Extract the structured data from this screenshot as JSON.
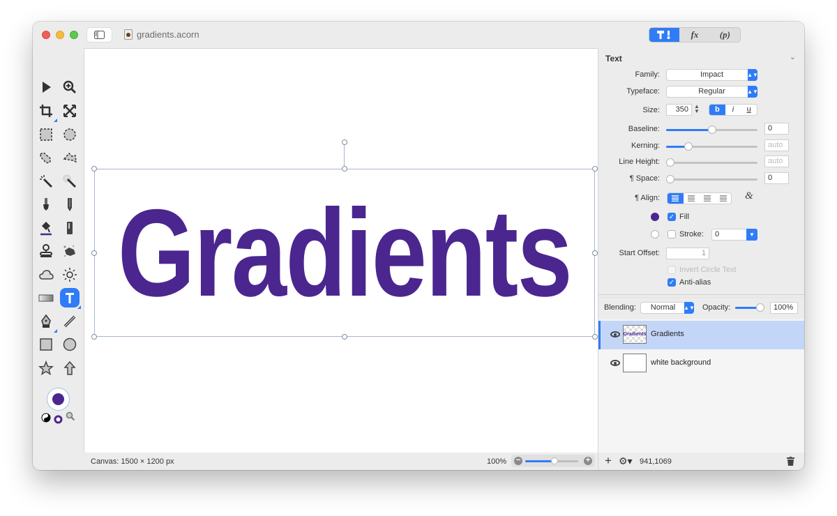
{
  "window": {
    "title": "gradients.acorn",
    "inspector_tabs": [
      {
        "label": "tools-icon",
        "active": true
      },
      {
        "label": "fx",
        "active": false
      },
      {
        "label": "(p)",
        "active": false
      }
    ]
  },
  "toolbox": {
    "tools": [
      {
        "name": "select-arrow-icon"
      },
      {
        "name": "zoom-icon"
      },
      {
        "name": "crop-icon"
      },
      {
        "name": "transform-icon"
      },
      {
        "name": "rect-marquee-icon"
      },
      {
        "name": "ellipse-marquee-icon"
      },
      {
        "name": "lasso-icon"
      },
      {
        "name": "polygon-lasso-icon"
      },
      {
        "name": "magic-wand-icon"
      },
      {
        "name": "instant-alpha-icon"
      },
      {
        "name": "brush-icon"
      },
      {
        "name": "pencil-icon"
      },
      {
        "name": "paint-bucket-icon"
      },
      {
        "name": "eraser-icon"
      },
      {
        "name": "clone-stamp-icon"
      },
      {
        "name": "smudge-icon"
      },
      {
        "name": "cloud-icon"
      },
      {
        "name": "sun-icon"
      },
      {
        "name": "gradient-icon"
      },
      {
        "name": "text-tool-icon",
        "selected": true
      },
      {
        "name": "pen-icon"
      },
      {
        "name": "line-icon"
      },
      {
        "name": "rectangle-shape-icon"
      },
      {
        "name": "oval-shape-icon"
      },
      {
        "name": "star-icon"
      },
      {
        "name": "arrow-shape-icon"
      }
    ],
    "foreground_color": "#4b268f"
  },
  "canvas": {
    "text": "Gradients",
    "text_color": "#4b268f"
  },
  "status": {
    "canvas_size": "Canvas: 1500 × 1200 px",
    "zoom_pct": "100%",
    "zoom_level": 0.55,
    "cursor_coords": "941,1069"
  },
  "inspector": {
    "section_title": "Text",
    "family_label": "Family:",
    "family_value": "Impact",
    "typeface_label": "Typeface:",
    "typeface_value": "Regular",
    "size_label": "Size:",
    "size_value": "350",
    "style_buttons": [
      "b",
      "i",
      "u"
    ],
    "baseline_label": "Baseline:",
    "baseline_value": "0",
    "baseline_slider": 0.5,
    "kerning_label": "Kerning:",
    "kerning_value": "auto",
    "kerning_slider": 0.22,
    "line_height_label": "Line Height:",
    "line_height_value": "auto",
    "line_height_slider": 0.0,
    "para_space_label": "¶ Space:",
    "para_space_value": "0",
    "para_space_slider": 0.0,
    "align_label": "¶ Align:",
    "fill_label": "Fill",
    "fill_checked": true,
    "fill_color": "#4b268f",
    "stroke_label": "Stroke:",
    "stroke_checked": false,
    "stroke_value": "0",
    "start_offset_label": "Start Offset:",
    "start_offset_value": "1",
    "invert_circle_label": "Invert Circle Text",
    "antialias_label": "Anti-alias",
    "antialias_checked": true,
    "blending_label": "Blending:",
    "blending_value": "Normal",
    "opacity_label": "Opacity:",
    "opacity_value": "100%",
    "opacity_slider": 1.0
  },
  "layers": [
    {
      "name": "Gradients",
      "thumb_text": "Gradients",
      "selected": true,
      "visible": true
    },
    {
      "name": "white background",
      "selected": false,
      "visible": true
    }
  ]
}
